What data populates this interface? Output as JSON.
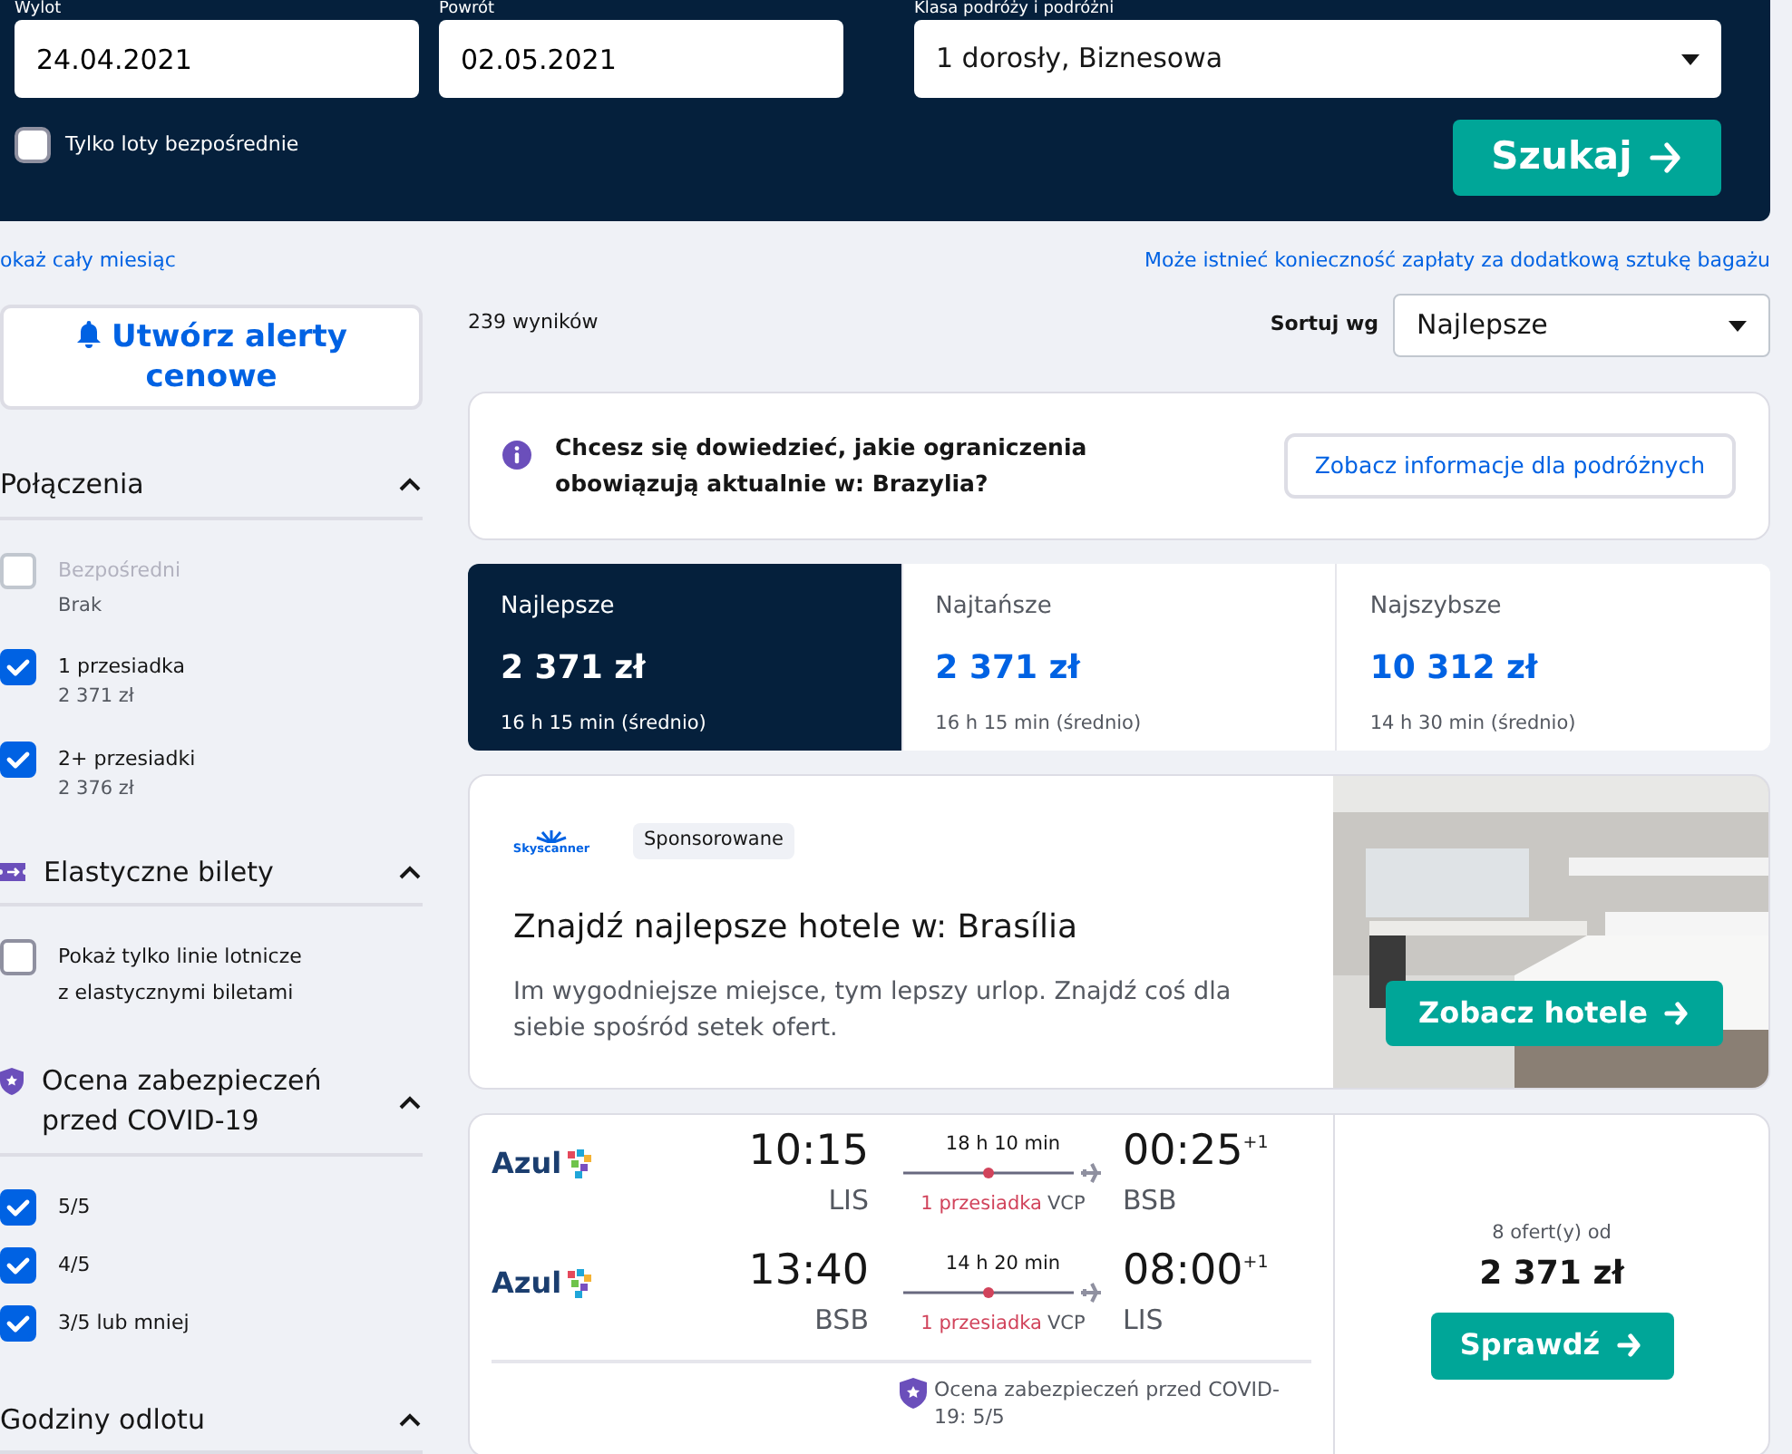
{
  "search_form": {
    "fields": [
      {
        "label": "Wylot",
        "value": "24.04.2021"
      },
      {
        "label": "Powrót",
        "value": "02.05.2021"
      }
    ],
    "travellers": {
      "label": "Klasa podróży i podróżni",
      "value": "1 dorosły, Biznesowa"
    },
    "direct_only": {
      "label": "Tylko loty bezpośrednie",
      "checked": false
    },
    "search_button": "Szukaj"
  },
  "links": {
    "month": "okaż cały miesiąc",
    "baggage": "Może istnieć konieczność zapłaty za dodatkową sztukę bagażu"
  },
  "sidebar": {
    "alert_button": "Utwórz alerty cenowe",
    "sections": [
      {
        "title": "Połączenia",
        "expanded": true,
        "options": [
          {
            "label": "Bezpośredni",
            "sublabel": "Brak",
            "checked": false,
            "disabled": true
          },
          {
            "label": "1 przesiadka",
            "sublabel": "2 371 zł",
            "checked": true,
            "disabled": false
          },
          {
            "label": "2+ przesiadki",
            "sublabel": "2 376 zł",
            "checked": true,
            "disabled": false
          }
        ]
      },
      {
        "title": "Elastyczne bilety",
        "expanded": true,
        "options": [
          {
            "label": "Pokaż tylko linie lotnicze z elastycznymi biletami",
            "checked": false,
            "disabled": false
          }
        ]
      },
      {
        "title": "Ocena zabezpieczeń przed COVID-19",
        "expanded": true,
        "options": [
          {
            "label": "5/5",
            "checked": true,
            "disabled": false
          },
          {
            "label": "4/5",
            "checked": true,
            "disabled": false
          },
          {
            "label": "3/5 lub mniej",
            "checked": true,
            "disabled": false
          }
        ]
      },
      {
        "title": "Godziny odlotu",
        "expanded": true
      }
    ]
  },
  "results": {
    "count": "239 wyników",
    "sort_label": "Sortuj wg",
    "sort_value": "Najlepsze",
    "info_banner": {
      "text": "Chcesz się dowiedzieć, jakie ograniczenia obowiązują aktualnie w: Brazylia?",
      "button": "Zobacz informacje dla podróżnych"
    },
    "tabs": [
      {
        "label": "Najlepsze",
        "price": "2 371 zł",
        "duration": "16 h 15 min (średnio)",
        "selected": true
      },
      {
        "label": "Najtańsze",
        "price": "2 371 zł",
        "duration": "16 h 15 min (średnio)",
        "selected": false
      },
      {
        "label": "Najszybsze",
        "price": "10 312 zł",
        "duration": "14 h 30 min (średnio)",
        "selected": false
      }
    ],
    "ad": {
      "logo": "Skyscanner",
      "badge": "Sponsorowane",
      "title": "Znajdź najlepsze hotele w: Brasília",
      "text": "Im wygodniejsze miejsce, tym lepszy urlop. Znajdź coś dla siebie spośród setek ofert.",
      "button": "Zobacz hotele"
    },
    "flight": {
      "legs": [
        {
          "airline": "Azul",
          "depart_time": "10:15",
          "depart_airport": "LIS",
          "duration": "18 h 10 min",
          "stops": "1 przesiadka",
          "via": "VCP",
          "arrive_time": "00:25",
          "day_offset": "+1",
          "arrive_airport": "BSB"
        },
        {
          "airline": "Azul",
          "depart_time": "13:40",
          "depart_airport": "BSB",
          "duration": "14 h 20 min",
          "stops": "1 przesiadka",
          "via": "VCP",
          "arrive_time": "08:00",
          "day_offset": "+1",
          "arrive_airport": "LIS"
        }
      ],
      "covid_note": "Ocena zabezpieczeń przed COVID-19: 5/5",
      "offers": "8 ofert(y) od",
      "price": "2 371 zł",
      "button": "Sprawdź"
    }
  }
}
